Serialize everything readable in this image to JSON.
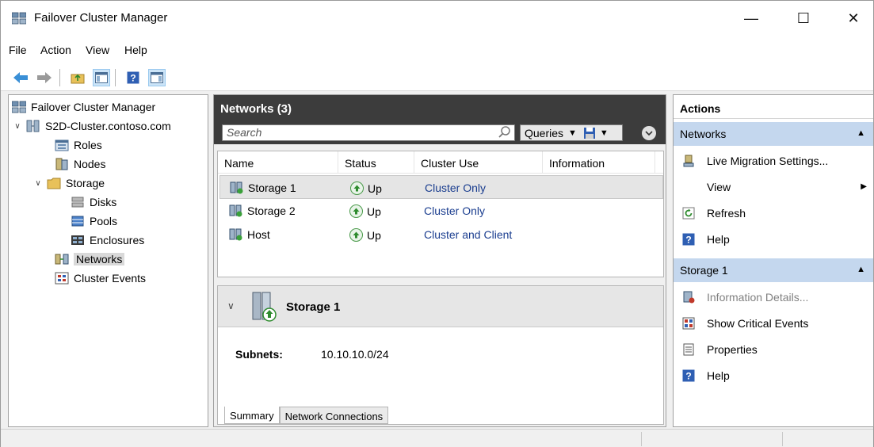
{
  "window": {
    "title": "Failover Cluster Manager",
    "minimize": "—",
    "maximize": "☐",
    "close": "✕"
  },
  "menu": [
    "File",
    "Action",
    "View",
    "Help"
  ],
  "tree": {
    "items": [
      {
        "label": "Failover Cluster Manager"
      },
      {
        "label": "S2D-Cluster.contoso.com"
      },
      {
        "label": "Roles"
      },
      {
        "label": "Nodes"
      },
      {
        "label": "Storage"
      },
      {
        "label": "Disks"
      },
      {
        "label": "Pools"
      },
      {
        "label": "Enclosures"
      },
      {
        "label": "Networks"
      },
      {
        "label": "Cluster Events"
      }
    ]
  },
  "center": {
    "header": "Networks (3)",
    "search_placeholder": "Search",
    "queries_label": "Queries",
    "columns": [
      "Name",
      "Status",
      "Cluster Use",
      "Information"
    ],
    "rows": [
      {
        "name": "Storage 1",
        "status": "Up",
        "cluster_use": "Cluster Only",
        "information": ""
      },
      {
        "name": "Storage 2",
        "status": "Up",
        "cluster_use": "Cluster Only",
        "information": ""
      },
      {
        "name": "Host",
        "status": "Up",
        "cluster_use": "Cluster and Client",
        "information": ""
      }
    ],
    "detail": {
      "title": "Storage 1",
      "subnets_label": "Subnets:",
      "subnets_value": "10.10.10.0/24",
      "tabs": [
        "Summary",
        "Network Connections"
      ]
    }
  },
  "actions": {
    "title": "Actions",
    "sections": [
      {
        "label": "Networks",
        "items": [
          {
            "label": "Live Migration Settings...",
            "icon": "live-migration-icon"
          },
          {
            "label": "View",
            "icon": "none"
          },
          {
            "label": "Refresh",
            "icon": "refresh-icon"
          },
          {
            "label": "Help",
            "icon": "help-icon"
          }
        ]
      },
      {
        "label": "Storage 1",
        "items": [
          {
            "label": "Information Details...",
            "icon": "information-details-icon"
          },
          {
            "label": "Show Critical Events",
            "icon": "critical-events-icon"
          },
          {
            "label": "Properties",
            "icon": "properties-icon"
          },
          {
            "label": "Help",
            "icon": "help-icon"
          }
        ]
      }
    ]
  },
  "colors": {
    "pane_header": "#3c3c3c",
    "actions_section": "#c4d7ee",
    "link_text": "#1a3d8f",
    "status_up": "#4a9a4a"
  }
}
